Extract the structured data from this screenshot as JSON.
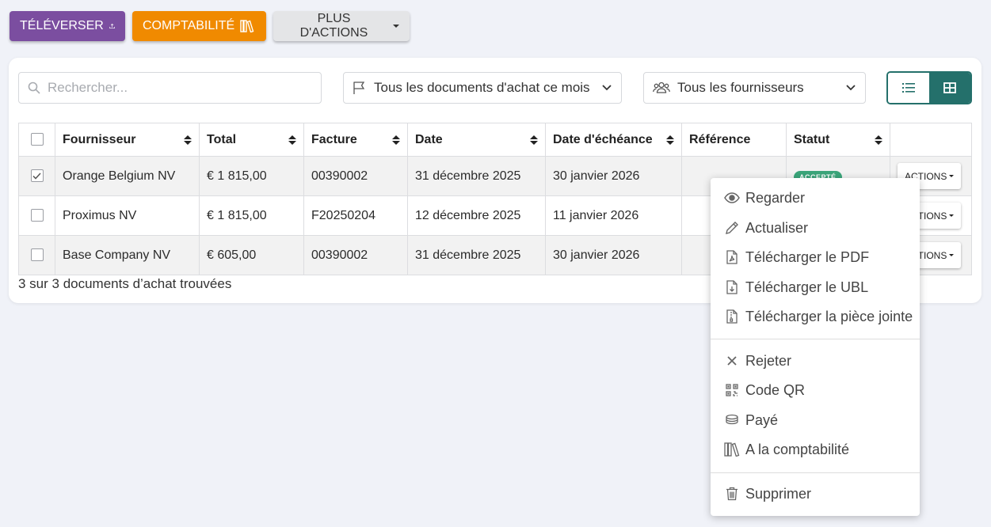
{
  "toolbar": {
    "upload_label": "TÉLÉVERSER",
    "compta_label": "COMPTABILITÉ",
    "more_label": "PLUS D'ACTIONS"
  },
  "filters": {
    "search_placeholder": "Rechercher...",
    "period": "Tous les documents d'achat ce mois",
    "supplier": "Tous les fournisseurs"
  },
  "table": {
    "headers": [
      "Fournisseur",
      "Total",
      "Facture",
      "Date",
      "Date d'échéance",
      "Référence",
      "Statut"
    ],
    "rows": [
      {
        "checked": true,
        "supplier": "Orange Belgium NV",
        "total": "€ 1 815,00",
        "invoice": "00390002",
        "date": "31 décembre 2025",
        "due": "30 janvier 2026",
        "reference": "",
        "status": "ACCEPTÉ",
        "actions": "ACTIONS"
      },
      {
        "checked": false,
        "supplier": "Proximus NV",
        "total": "€ 1 815,00",
        "invoice": "F20250204",
        "date": "12 décembre 2025",
        "due": "11 janvier 2026",
        "reference": "",
        "status": "",
        "actions": "ACTIONS"
      },
      {
        "checked": false,
        "supplier": "Base Company NV",
        "total": "€ 605,00",
        "invoice": "00390002",
        "date": "31 décembre 2025",
        "due": "30 janvier 2026",
        "reference": "",
        "status": "",
        "actions": "ACTIONS"
      }
    ],
    "footer": "3 sur 3 documents d’achat trouvées"
  },
  "menu": {
    "items": [
      {
        "label": "Regarder",
        "icon": "eye-icon"
      },
      {
        "label": "Actualiser",
        "icon": "pencil-icon"
      },
      {
        "label": "Télécharger le PDF",
        "icon": "pdf-file-icon"
      },
      {
        "label": "Télécharger le UBL",
        "icon": "download-file-icon"
      },
      {
        "label": "Télécharger la pièce jointe",
        "icon": "zip-file-icon"
      },
      {
        "label": "Rejeter",
        "icon": "close-icon"
      },
      {
        "label": "Code QR",
        "icon": "qr-code-icon"
      },
      {
        "label": "Payé",
        "icon": "coins-icon"
      },
      {
        "label": "A la comptabilité",
        "icon": "books-icon"
      },
      {
        "label": "Supprimer",
        "icon": "trash-icon"
      }
    ]
  },
  "colors": {
    "upload": "#7b4ea0",
    "compta": "#f08a00",
    "accent": "#24706b",
    "status_accepted": "#3aa57a"
  }
}
